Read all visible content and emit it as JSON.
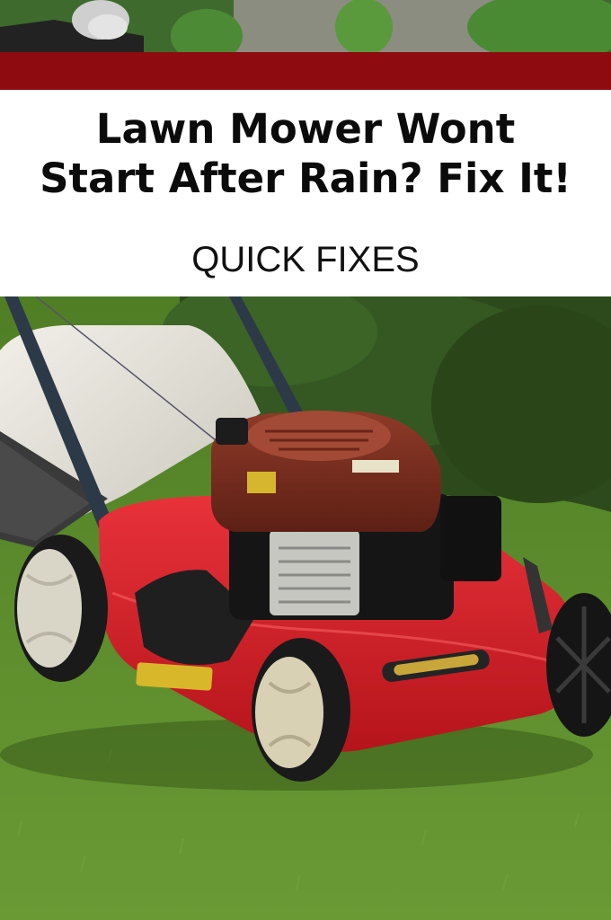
{
  "header": {
    "title_line1": "Lawn Mower Wont",
    "title_line2": "Start After Rain? Fix It!",
    "subtitle": "QUICK FIXES"
  },
  "colors": {
    "band": "#8e0b0f",
    "mower_deck": "#d61f26",
    "engine_cover": "#7a2a1c",
    "grass": "#5c8a2c"
  },
  "photos": {
    "top": "garden-with-gloved-hand-on-mower-handle",
    "main": "red-push-lawn-mower-on-grass"
  }
}
